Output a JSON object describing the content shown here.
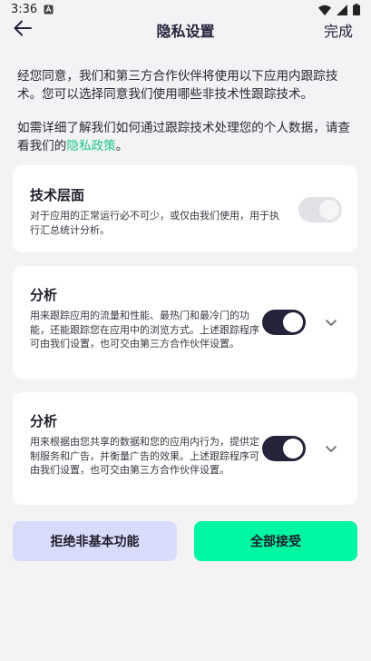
{
  "status_bar": {
    "time": "3:36"
  },
  "header": {
    "title": "隐私设置",
    "done_label": "完成"
  },
  "intro": {
    "paragraph1": "经您同意，我们和第三方合作伙伴将使用以下应用内跟踪技术。您可以选择同意我们使用哪些非技术性跟踪技术。",
    "paragraph2_text": "如需详细了解我们如何通过跟踪技术处理您的个人数据，请查看我们的",
    "policy_link": "隐私政策",
    "paragraph2_end": "。"
  },
  "sections": [
    {
      "title": "技术层面",
      "description": "对于应用的正常运行必不可少，或仅由我们使用，用于执行汇总统计分析。",
      "enabled": true,
      "locked": true
    },
    {
      "title": "分析",
      "description": "用来跟踪应用的流量和性能、最热门和最冷门的功能，还能跟踪您在应用中的浏览方式。上述跟踪程序可由我们设置，也可交由第三方合作伙伴设置。",
      "enabled": true,
      "locked": false
    },
    {
      "title": "分析",
      "description": "用来根据由您共享的数据和您的应用内行为，提供定制服务和广告，并衡量广告的效果。上述跟踪程序可由我们设置，也可交由第三方合作伙伴设置。",
      "enabled": true,
      "locked": false
    }
  ],
  "buttons": {
    "reject": "拒绝非基本功能",
    "accept": "全部接受"
  },
  "colors": {
    "accent": "#00f7a2",
    "link": "#20c98a",
    "toggle_on": "#23233a",
    "reject_bg": "#d9dbfb",
    "background": "#f3f3f6"
  }
}
